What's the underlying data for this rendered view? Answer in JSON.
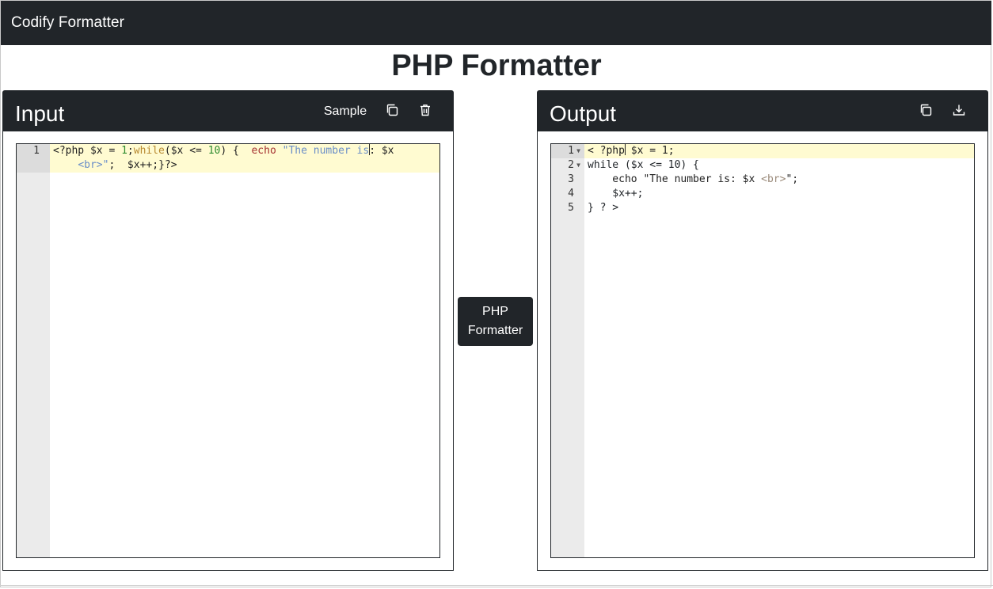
{
  "navbar": {
    "brand": "Codify Formatter"
  },
  "page_title": "PHP Formatter",
  "input_panel": {
    "title": "Input",
    "sample_label": "Sample",
    "copy_icon": "copy-icon",
    "clear_icon": "trash-icon",
    "line_numbers": [
      "1"
    ],
    "code": {
      "l1": {
        "a": "<?php $x = ",
        "b": "1",
        "c": ";",
        "d": "while",
        "e": "($x <= ",
        "f": "10",
        "g": ") {  ",
        "h": "echo",
        "i": " ",
        "j": "\"The number is",
        "k": ": $x"
      },
      "l2": {
        "a": "    ",
        "b": "<br>\"",
        "c": ";  $x++;}?>"
      }
    }
  },
  "convert_button": {
    "line1": "PHP",
    "line2": "Formatter"
  },
  "output_panel": {
    "title": "Output",
    "copy_icon": "copy-icon",
    "download_icon": "download-icon",
    "line_numbers": [
      "1",
      "2",
      "3",
      "4",
      "5"
    ],
    "lines": {
      "l1a": "< ?php",
      "l1b": " $x = 1;",
      "l2": "while ($x <= 10) {",
      "l3a": "    echo \"The number is: $x ",
      "l3b": "<br>",
      "l3c": "\";",
      "l4": "    $x++;",
      "l5": "} ? >"
    }
  },
  "colors": {
    "dark": "#212529",
    "gutter": "#ebebeb",
    "active_line": "#fffbd1"
  }
}
